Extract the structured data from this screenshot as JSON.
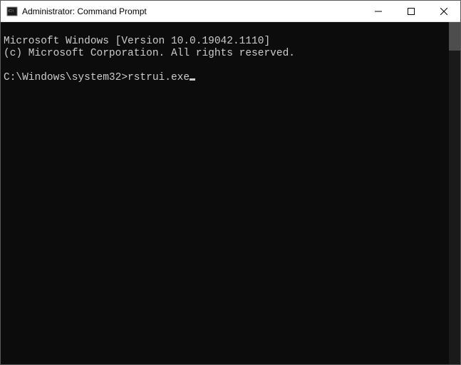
{
  "titlebar": {
    "title": "Administrator: Command Prompt"
  },
  "terminal": {
    "version_line": "Microsoft Windows [Version 10.0.19042.1110]",
    "copyright_line": "(c) Microsoft Corporation. All rights reserved.",
    "blank_line": "",
    "prompt": "C:\\Windows\\system32>",
    "input": "rstrui.exe"
  }
}
